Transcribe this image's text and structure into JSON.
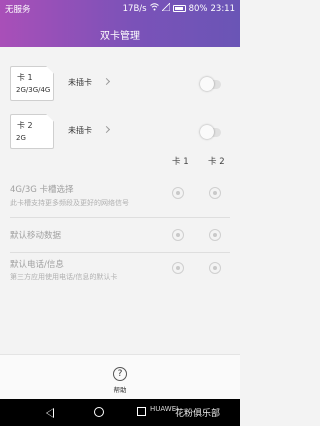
{
  "status_bar": {
    "carrier": "无服务",
    "speed": "17B/s",
    "battery": "80%",
    "time": "23:11"
  },
  "header": {
    "title": "双卡管理"
  },
  "sims": [
    {
      "name": "卡 1",
      "network": "2G/3G/4G",
      "status": "未插卡",
      "enabled": false
    },
    {
      "name": "卡 2",
      "network": "2G",
      "status": "未插卡",
      "enabled": false
    }
  ],
  "columns": {
    "card1": "卡 1",
    "card2": "卡 2"
  },
  "options": [
    {
      "title": "4G/3G 卡槽选择",
      "subtitle": "此卡槽支持更多频段及更好的网络信号",
      "selected": "none"
    },
    {
      "title": "默认移动数据",
      "subtitle": "",
      "selected": "none"
    },
    {
      "title": "默认电话/信息",
      "subtitle": "第三方应用使用电话/信息的默认卡",
      "selected": "none"
    }
  ],
  "help": {
    "label": "帮助",
    "icon": "help-icon"
  },
  "watermark": {
    "logo": "HUAWEI",
    "text": "花粉俱乐部"
  },
  "colors": {
    "header_start": "#a94fb8",
    "header_end": "#6a55b6"
  }
}
